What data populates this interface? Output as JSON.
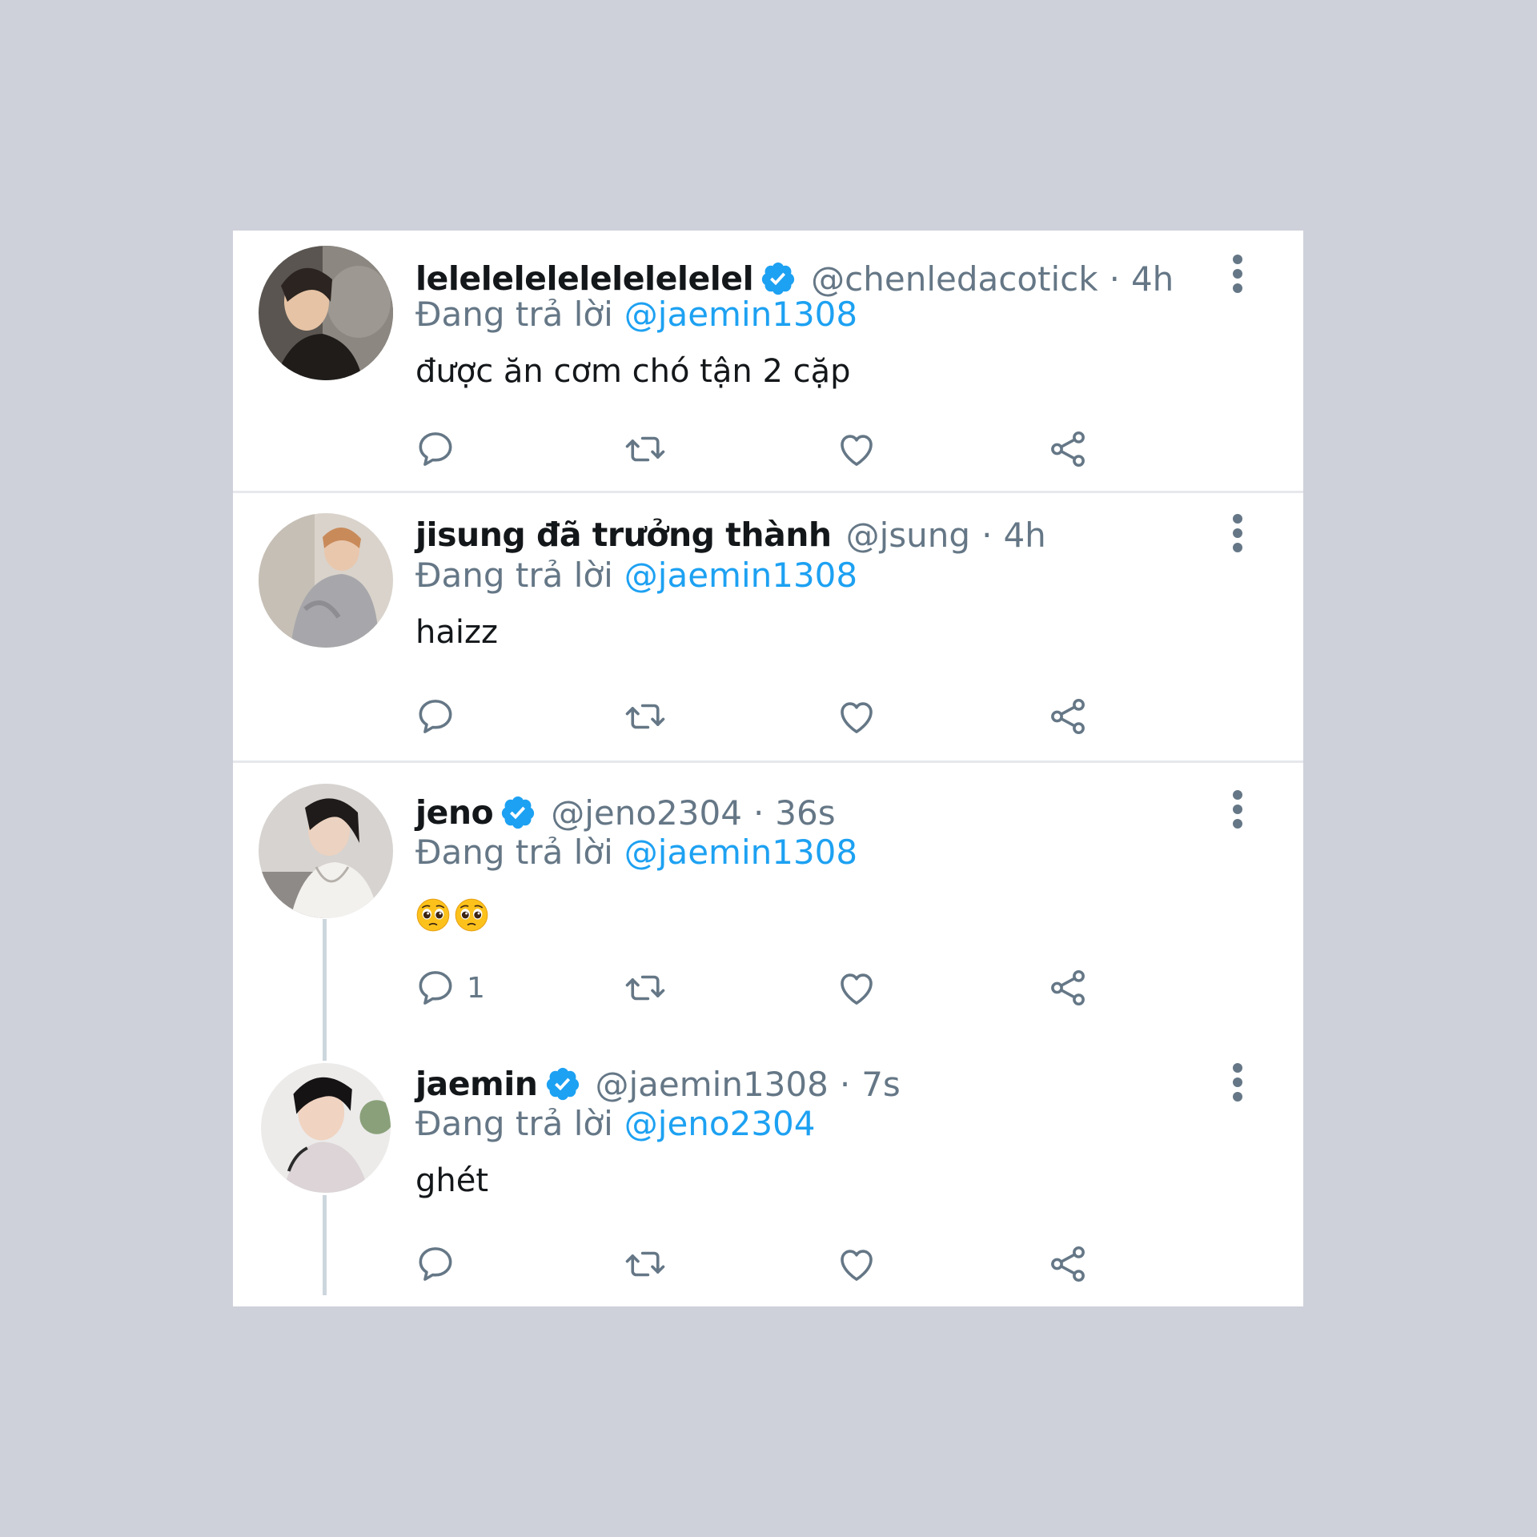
{
  "accent_color": "#1da1f2",
  "tweets": [
    {
      "name": "lelelelelelelelelelel",
      "verified": true,
      "handle": "@chenledacotick",
      "time": "4h",
      "reply_prefix": "Đang trả lời",
      "reply_to": "@jaemin1308",
      "text": "được ăn cơm chó tận 2 cặp",
      "reply_count": ""
    },
    {
      "name": "jisung đã trưởng thành",
      "verified": false,
      "handle": "@jsung",
      "time": "4h",
      "reply_prefix": "Đang trả lời",
      "reply_to": "@jaemin1308",
      "text": "haizz",
      "reply_count": ""
    },
    {
      "name": "jeno",
      "verified": true,
      "handle": "@jeno2304",
      "time": "36s",
      "reply_prefix": "Đang trả lời",
      "reply_to": "@jaemin1308",
      "emoji": [
        "pleading-face",
        "pleading-face"
      ],
      "reply_count": "1"
    },
    {
      "name": "jaemin",
      "verified": true,
      "handle": "@jaemin1308",
      "time": "7s",
      "reply_prefix": "Đang trả lời",
      "reply_to": "@jeno2304",
      "text": "ghét",
      "reply_count": ""
    }
  ],
  "separator": "·"
}
